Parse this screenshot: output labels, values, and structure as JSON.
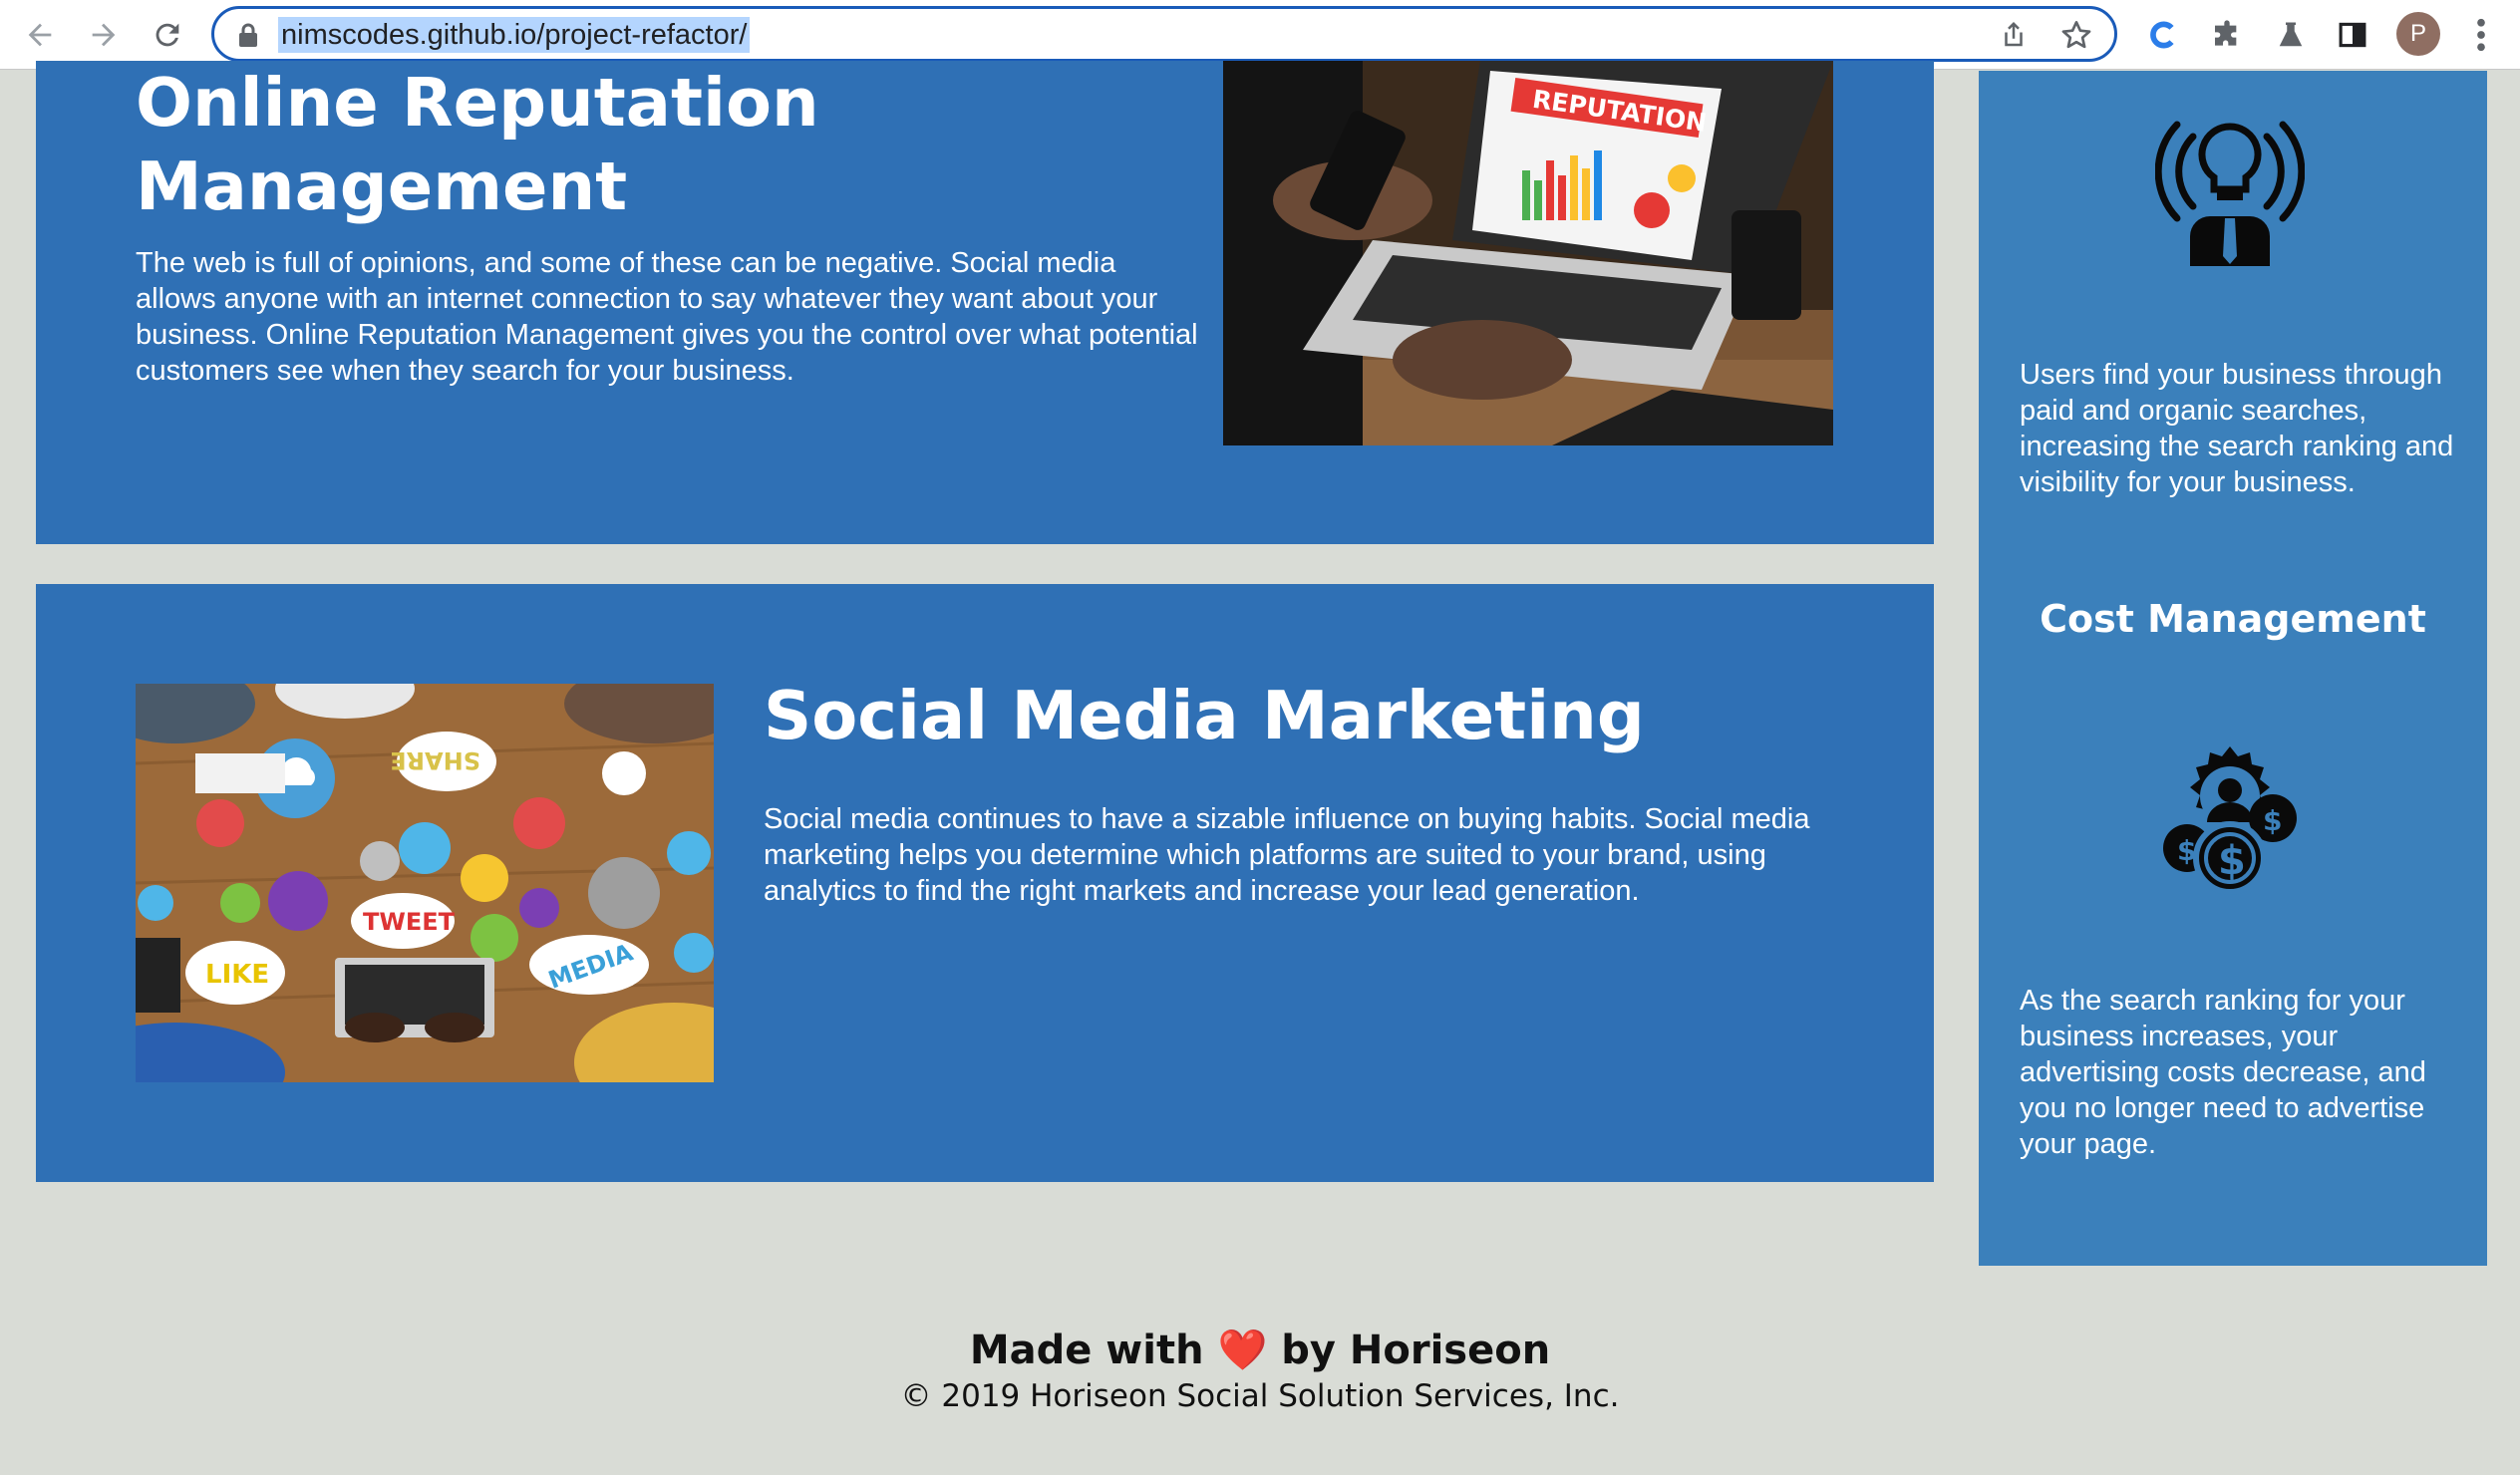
{
  "browser": {
    "url": "nimscodes.github.io/project-refactor/",
    "profile_initial": "P",
    "icons": [
      "back-arrow-icon",
      "forward-arrow-icon",
      "reload-icon",
      "lock-icon",
      "share-icon",
      "star-icon",
      "extension-c-icon",
      "puzzle-icon",
      "flask-icon",
      "sidebar-icon",
      "menu-dots-icon"
    ]
  },
  "content": {
    "reputation": {
      "title": "Online Reputation Management",
      "text": "The web is full of opinions, and some of these can be negative. Social media allows anyone with an internet connection to say whatever they want about your business. Online Reputation Management gives you the control over what potential customers see when they search for your business.",
      "image_sign": "REPUTATION"
    },
    "social": {
      "title": "Social Media Marketing",
      "text": "Social media continues to have a sizable influence on buying habits. Social media marketing helps you determine which platforms are suited to your brand, using analytics to find the right markets and increase your lead generation.",
      "image_words": {
        "share": "SHARE",
        "tweet": "TWEET",
        "like": "LIKE",
        "media": "MEDIA"
      }
    }
  },
  "sidebar": {
    "search_text": "Users find your business through paid and organic searches, increasing the search ranking and visibility for your business.",
    "cost_title": "Cost Management",
    "cost_text": "As the search ranking for your business increases, your advertising costs decrease, and you no longer need to advertise your page."
  },
  "footer": {
    "made_prefix": "Made with",
    "heart": "❤️",
    "made_suffix": "by Horiseon",
    "copyright": "© 2019 Horiseon Social Solution Services, Inc."
  },
  "colors": {
    "card_blue": "#2f70b5",
    "sidebar_blue": "#3b80bb",
    "page_background": "#d9dcd6",
    "url_highlight": "#b4d5fe",
    "omnibox_border": "#1a5bb9"
  }
}
